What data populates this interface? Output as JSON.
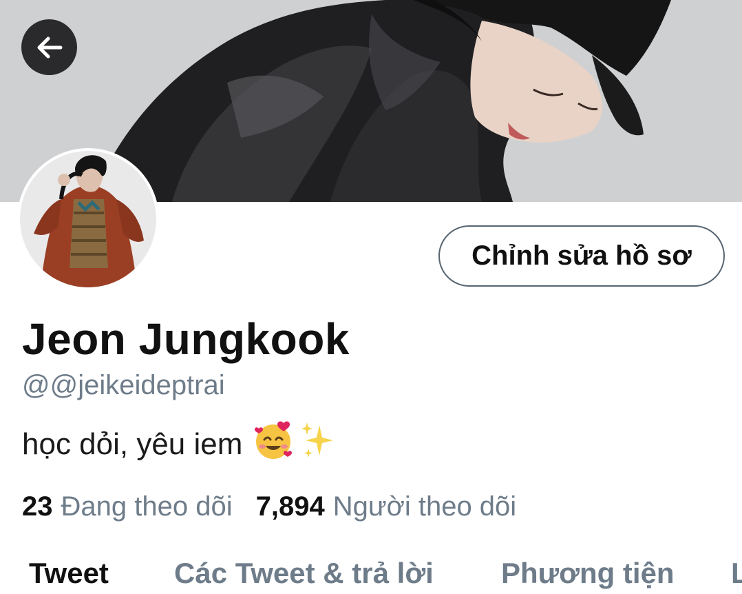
{
  "header": {
    "back_icon": "arrow-left-icon",
    "back_button_color": "#2a2a2c"
  },
  "profile": {
    "edit_button_label": "Chỉnh sửa hồ sơ",
    "display_name": "Jeon Jungkook",
    "handle": "@@jeikeideptrai",
    "bio": "học dỏi, yêu iem",
    "bio_emojis": [
      "smiling-face-with-hearts",
      "sparkles"
    ]
  },
  "stats": {
    "following_count": "23",
    "following_label": "Đang theo dõi",
    "followers_count": "7,894",
    "followers_label": "Người theo dõi"
  },
  "tabs": [
    {
      "label": "Tweet",
      "active": true
    },
    {
      "label": "Các Tweet & trả lời",
      "active": false
    },
    {
      "label": "Phương tiện",
      "active": false
    },
    {
      "label": "L",
      "active": false
    }
  ],
  "colors": {
    "text_primary": "#111111",
    "text_secondary": "#6e7c8a",
    "button_border": "#566470"
  }
}
